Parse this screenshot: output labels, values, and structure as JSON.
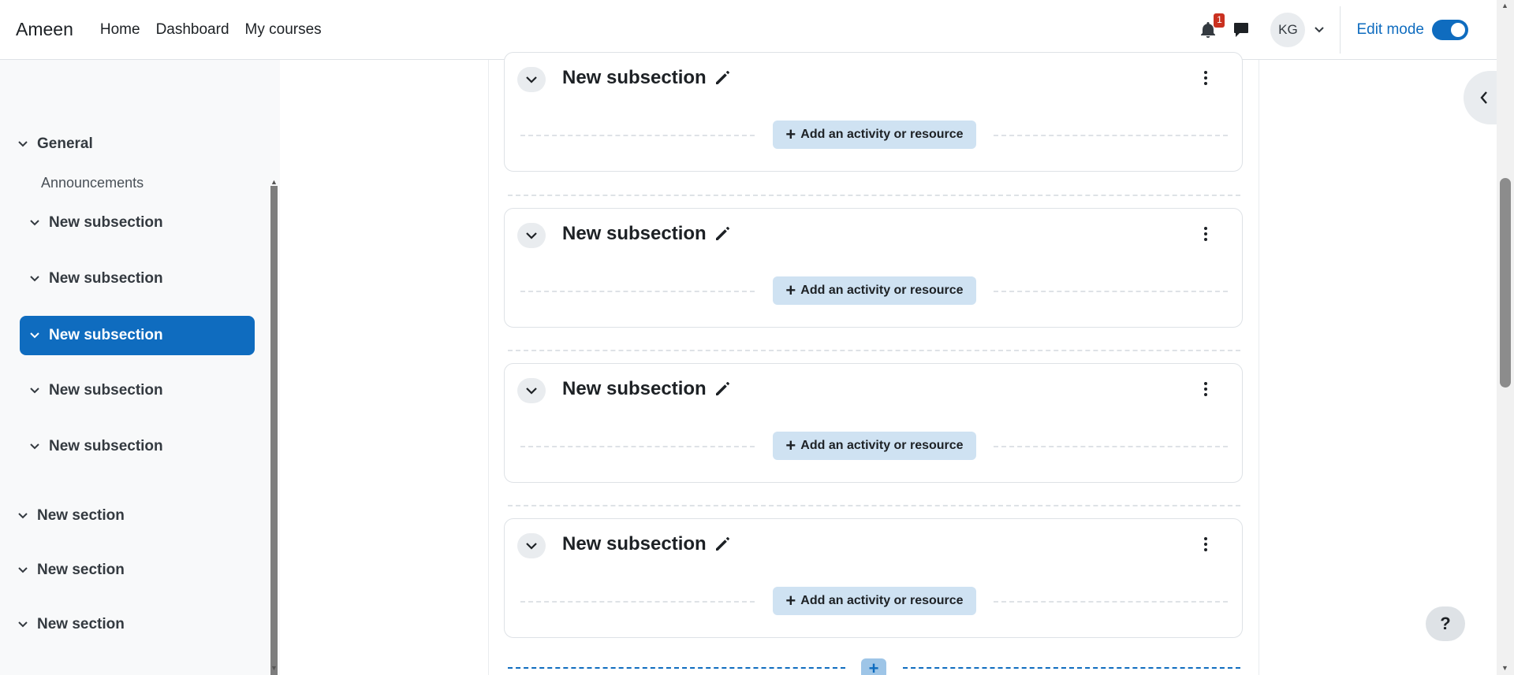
{
  "navbar": {
    "brand": "Ameen",
    "links": [
      "Home",
      "Dashboard",
      "My courses"
    ],
    "notification_count": "1",
    "user_initials": "KG",
    "edit_mode_label": "Edit mode",
    "edit_mode_on": true
  },
  "course_index": {
    "items": [
      {
        "type": "section",
        "label": "General"
      },
      {
        "type": "activity",
        "label": "Announcements"
      },
      {
        "type": "subsection",
        "label": "New subsection"
      },
      {
        "type": "subsection",
        "label": "New subsection"
      },
      {
        "type": "subsection",
        "label": "New subsection",
        "active": true
      },
      {
        "type": "subsection",
        "label": "New subsection"
      },
      {
        "type": "subsection",
        "label": "New subsection"
      },
      {
        "type": "section",
        "label": "New section"
      },
      {
        "type": "section",
        "label": "New section"
      },
      {
        "type": "section",
        "label": "New section"
      }
    ]
  },
  "main": {
    "cards": [
      {
        "title": "New subsection",
        "add_label": "Add an activity or resource"
      },
      {
        "title": "New subsection",
        "add_label": "Add an activity or resource"
      },
      {
        "title": "New subsection",
        "add_label": "Add an activity or resource"
      },
      {
        "title": "New subsection",
        "add_label": "Add an activity or resource"
      }
    ]
  },
  "help": {
    "label": "?"
  },
  "colors": {
    "accent": "#0f6cbf",
    "badge": "#ca3120",
    "add_button_bg": "#cfe2f2"
  }
}
